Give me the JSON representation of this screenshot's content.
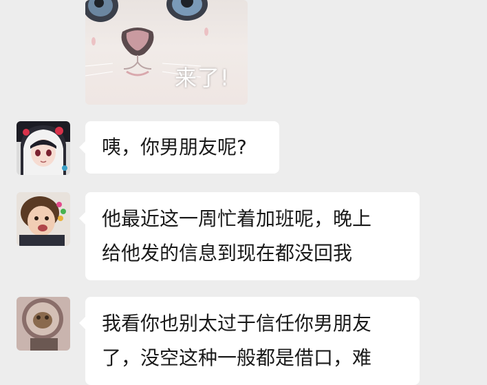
{
  "sticker": {
    "caption": "来了!"
  },
  "messages": [
    {
      "avatar": "anime-girl-avatar",
      "lines": [
        "咦，你男朋友呢?"
      ]
    },
    {
      "avatar": "baby-avatar",
      "lines": [
        "他最近这一周忙着加班呢，晚上",
        "给他发的信息到现在都没回我"
      ]
    },
    {
      "avatar": "cat-mirror-avatar",
      "lines": [
        "我看你也别太过于信任你男朋友",
        "了，没空这种一般都是借口，难"
      ]
    }
  ]
}
